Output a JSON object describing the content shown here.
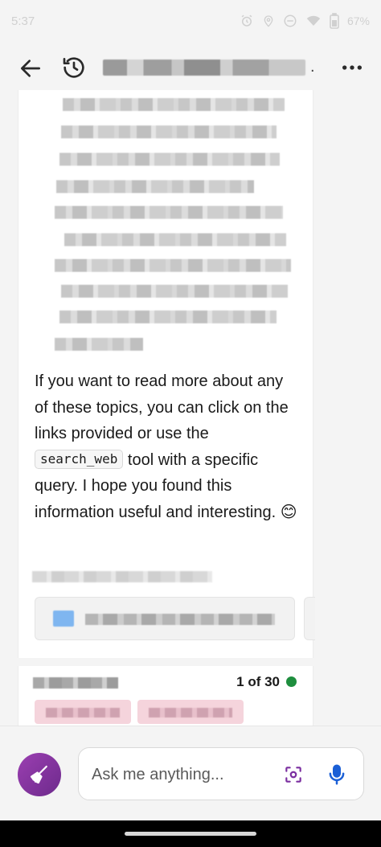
{
  "status_bar": {
    "time": "5:37",
    "battery": "67%"
  },
  "app_bar": {
    "title_suffix": "."
  },
  "answer": {
    "line_1": "If you want to read more about any of these topics, you can click on the links provided or use the",
    "code": "search_web",
    "line_2": "tool with a specific query. I hope you found this information useful and interesting.",
    "emoji": "😊"
  },
  "response_counter": {
    "text": "1 of 30",
    "status_color": "#1e8e3e"
  },
  "composer": {
    "placeholder": "Ask me anything..."
  },
  "colors": {
    "accent": "#7b2fa0",
    "mic": "#1a5fd6"
  },
  "icons": [
    "back-arrow-icon",
    "history-icon",
    "more-icon",
    "broom-icon",
    "visual-search-icon",
    "mic-icon",
    "alarm-icon",
    "location-icon",
    "dnd-icon",
    "wifi-icon",
    "battery-icon"
  ]
}
